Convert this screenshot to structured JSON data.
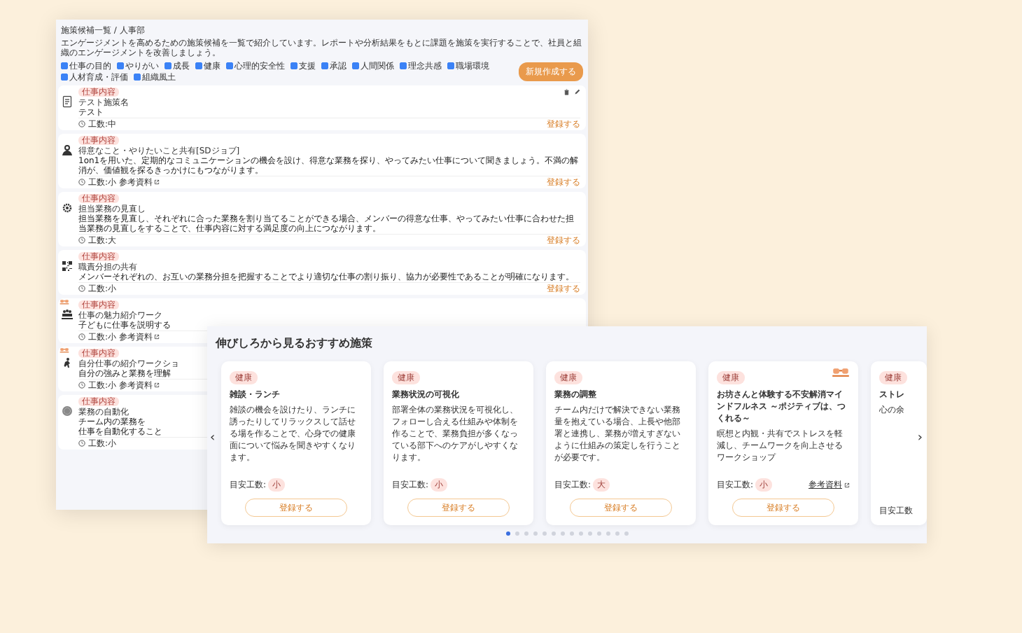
{
  "list_window": {
    "breadcrumb": "施策候補一覧 / 人事部",
    "description": "エンゲージメントを高めるための施策候補を一覧で紹介しています。レポートや分析結果をもとに課題を施策を実行することで、社員と組織のエンゲージメントを改善しましょう。",
    "filters": [
      {
        "label": "仕事の目的",
        "checked": true
      },
      {
        "label": "やりがい",
        "checked": true
      },
      {
        "label": "成長",
        "checked": true
      },
      {
        "label": "健康",
        "checked": true
      },
      {
        "label": "心理的安全性",
        "checked": true
      },
      {
        "label": "支援",
        "checked": true
      },
      {
        "label": "承認",
        "checked": true
      },
      {
        "label": "人間関係",
        "checked": true
      },
      {
        "label": "理念共感",
        "checked": true
      },
      {
        "label": "職場環境",
        "checked": true
      },
      {
        "label": "人材育成・評価",
        "checked": true
      },
      {
        "label": "組織風土",
        "checked": true
      }
    ],
    "create_button": "新規作成する",
    "items": [
      {
        "tag": "仕事内容",
        "title": "テスト施策名",
        "description": "テスト",
        "effort": "工数:中",
        "editable": true,
        "featured": false,
        "link": "登録する"
      },
      {
        "tag": "仕事内容",
        "title": "得意なこと・やりたいこと共有[SDジョブ]",
        "description": "1on1を用いた、定期的なコミュニケーションの機会を設け、得意な業務を探り、やってみたい仕事について聞きましょう。不満の解消が、価値観を探るきっかけにもつながります。",
        "effort": "工数:小",
        "reference": "参考資料",
        "editable": false,
        "featured": false,
        "link": "登録する"
      },
      {
        "tag": "仕事内容",
        "title": "担当業務の見直し",
        "description": "担当業務を見直し、それぞれに合った業務を割り当てることができる場合、メンバーの得意な仕事、やってみたい仕事に合わせた担当業務の見直しをすることで、仕事内容に対する満足度の向上につながります。",
        "effort": "工数:大",
        "editable": false,
        "featured": false,
        "link": "登録する"
      },
      {
        "tag": "仕事内容",
        "title": "職責分担の共有",
        "description": "メンバーそれぞれの、お互いの業務分担を把握することでより適切な仕事の割り振り、協力が必要性であることが明確になります。",
        "effort": "工数:小",
        "editable": false,
        "featured": false,
        "link": "登録する"
      },
      {
        "tag": "仕事内容",
        "title": "仕事の魅力紹介ワーク",
        "description": "子どもに仕事を説明する",
        "effort": "工数:小",
        "reference": "参考資料",
        "editable": false,
        "featured": true
      },
      {
        "tag": "仕事内容",
        "title": "自分仕事の紹介ワークショ",
        "description": "自分の強みと業務を理解",
        "effort": "工数:小",
        "reference": "参考資料",
        "editable": false,
        "featured": true
      },
      {
        "tag": "仕事内容",
        "title": "業務の自動化",
        "description": "チーム内の業務を",
        "description_2": "仕事を自動化すること",
        "effort": "工数:小",
        "editable": false,
        "featured": false
      }
    ]
  },
  "recommend_panel": {
    "title": "伸びしろから見るおすすめ施策",
    "prev": "‹",
    "next": "›",
    "cards": [
      {
        "tag": "健康",
        "title": "雑談・ランチ",
        "description": "雑談の機会を設けたり、ランチに誘ったりしてリラックスして話せる場を作ることで、心身での健康面について悩みを聞きやすくなります。",
        "effort_label": "目安工数:",
        "effort": "小",
        "button": "登録する",
        "featured": false
      },
      {
        "tag": "健康",
        "title": "業務状況の可視化",
        "description": "部署全体の業務状況を可視化し、フォローし合える仕組みや体制を作ることで、業務負担が多くなっている部下へのケアがしやすくなります。",
        "effort_label": "目安工数:",
        "effort": "小",
        "button": "登録する",
        "featured": false
      },
      {
        "tag": "健康",
        "title": "業務の調整",
        "description": "チーム内だけで解決できない業務量を抱えている場合、上長や他部署と連携し、業務が増えすぎないように仕組みの策定しを行うことが必要です。",
        "effort_label": "目安工数:",
        "effort": "大",
        "button": "登録する",
        "featured": false
      },
      {
        "tag": "健康",
        "title": "お坊さんと体験する不安解消マインドフルネス ～ポジティブは、つくれる～",
        "description": "瞑想と内観・共有でストレスを軽減し、チームワークを向上させるワークショップ",
        "effort_label": "目安工数:",
        "effort": "小",
        "reference": "参考資料",
        "button": "登録する",
        "featured": true
      },
      {
        "tag": "健康",
        "title": "ストレ",
        "description": "心の余",
        "effort_label": "目安工数",
        "featured": false
      }
    ],
    "pages": [
      {
        "selected": true
      },
      {
        "selected": false
      },
      {
        "selected": false
      },
      {
        "selected": false
      },
      {
        "selected": false
      },
      {
        "selected": false
      },
      {
        "selected": false
      },
      {
        "selected": false
      },
      {
        "selected": false
      },
      {
        "selected": false
      },
      {
        "selected": false
      },
      {
        "selected": false
      },
      {
        "selected": false
      },
      {
        "selected": false
      }
    ]
  }
}
